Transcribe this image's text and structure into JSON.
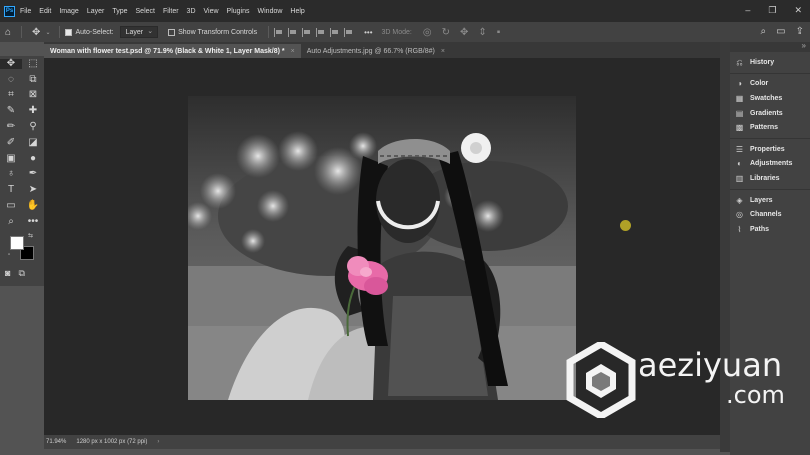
{
  "app": {
    "logo_text": "Ps"
  },
  "menu": [
    "File",
    "Edit",
    "Image",
    "Layer",
    "Type",
    "Select",
    "Filter",
    "3D",
    "View",
    "Plugins",
    "Window",
    "Help"
  ],
  "options_bar": {
    "auto_select_label": "Auto-Select:",
    "auto_select_checked": true,
    "auto_select_target": "Layer",
    "show_transform_label": "Show Transform Controls",
    "show_transform_checked": false,
    "mode_3d_label": "3D Mode:"
  },
  "tabs": [
    {
      "title": "Woman with flower test.psd @ 71.9% (Black & White 1, Layer Mask/8) *",
      "active": true
    },
    {
      "title": "Auto Adjustments.jpg @ 66.7% (RGB/8#)",
      "active": false
    }
  ],
  "status": {
    "zoom": "71.94%",
    "doc_size": "1280 px x 1002 px (72 ppi)"
  },
  "colors": {
    "foreground": "#ffffff",
    "background": "#000000",
    "accent_flower": "#e86aa8"
  },
  "panels": [
    [
      {
        "label": "History",
        "icon": "history-icon"
      }
    ],
    [
      {
        "label": "Color",
        "icon": "color-wheel-icon"
      },
      {
        "label": "Swatches",
        "icon": "grid-icon"
      },
      {
        "label": "Gradients",
        "icon": "gradient-icon"
      },
      {
        "label": "Patterns",
        "icon": "pattern-icon"
      }
    ],
    [
      {
        "label": "Properties",
        "icon": "sliders-icon"
      },
      {
        "label": "Adjustments",
        "icon": "half-circle-icon"
      },
      {
        "label": "Libraries",
        "icon": "library-icon"
      }
    ],
    [
      {
        "label": "Layers",
        "icon": "layers-icon"
      },
      {
        "label": "Channels",
        "icon": "channels-icon"
      },
      {
        "label": "Paths",
        "icon": "paths-icon"
      }
    ]
  ],
  "watermark": {
    "name": "aeziyuan",
    "domain": ".com"
  }
}
